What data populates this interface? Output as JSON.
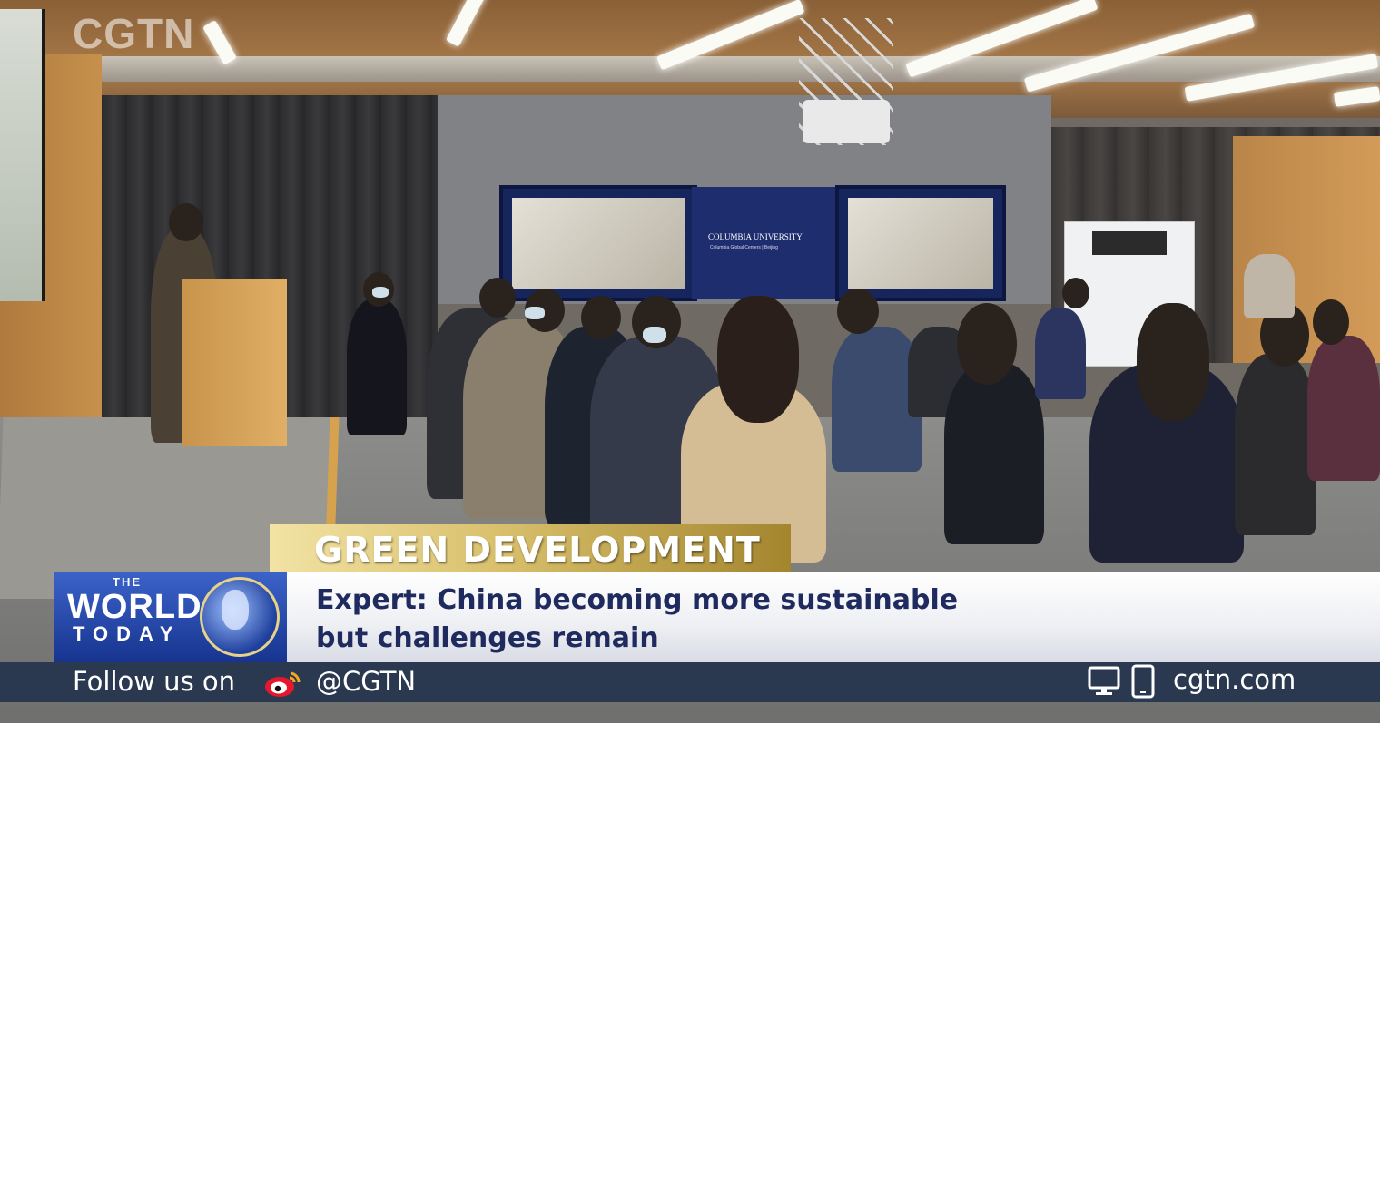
{
  "broadcast": {
    "channel_logo": "CGTN",
    "category": "GREEN DEVELOPMENT",
    "headline_line1": "Expert: China becoming more sustainable",
    "headline_line2": "but challenges remain",
    "program": {
      "top": "THE",
      "middle": "WORLD",
      "bottom": "TODAY"
    },
    "follow": {
      "label": "Follow us on",
      "handle": "@CGTN",
      "website": "cgtn.com"
    },
    "scene_banner": {
      "line1": "COLUMBIA UNIVERSITY",
      "line2": "Columbia Global Centers | Beijing"
    }
  },
  "icons": [
    "weibo-icon",
    "monitor-icon",
    "phone-icon",
    "globe-icon"
  ],
  "colors": {
    "gold": "#d8bf6b",
    "navy_text": "#1f2a5e",
    "follow_bar": "#2a3950",
    "program_blue": "#2a4fb3"
  }
}
